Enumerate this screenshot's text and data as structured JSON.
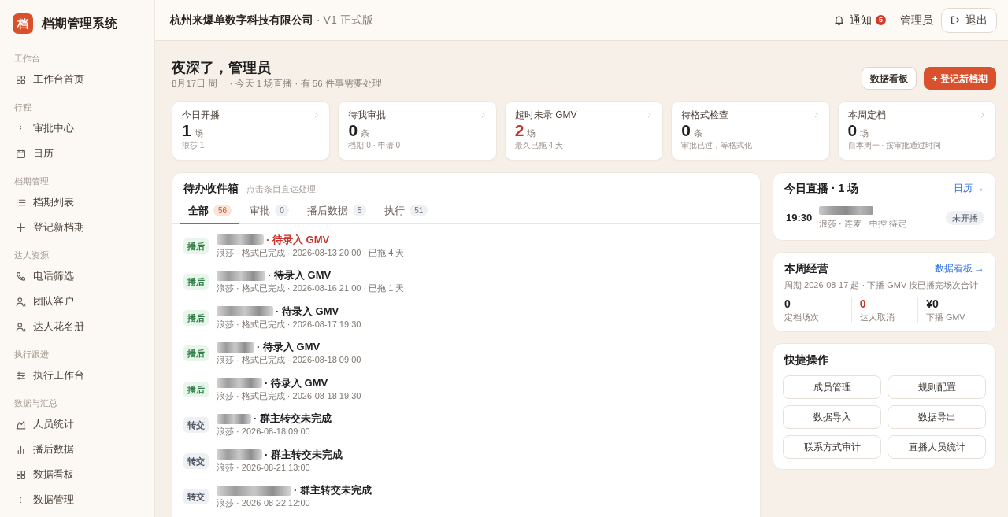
{
  "sidebar": {
    "logo": "档",
    "title": "档期管理系统",
    "sections": [
      {
        "label": "工作台",
        "items": [
          {
            "label": "工作台首页",
            "selected": false
          }
        ]
      },
      {
        "label": "行程",
        "items": [
          {
            "label": "审批中心",
            "selected": false
          },
          {
            "label": "日历",
            "selected": false
          }
        ]
      },
      {
        "label": "档期管理",
        "items": [
          {
            "label": "档期列表",
            "selected": false
          },
          {
            "label": "登记新档期",
            "selected": false
          }
        ]
      },
      {
        "label": "达人资源",
        "items": [
          {
            "label": "电话筛选",
            "selected": false
          },
          {
            "label": "团队客户",
            "selected": false
          },
          {
            "label": "达人花名册",
            "selected": false
          }
        ]
      },
      {
        "label": "执行跟进",
        "items": [
          {
            "label": "执行工作台",
            "selected": false
          }
        ]
      },
      {
        "label": "数据与汇总",
        "items": [
          {
            "label": "人员统计",
            "selected": false
          },
          {
            "label": "播后数据",
            "selected": false
          },
          {
            "label": "数据看板",
            "selected": false
          },
          {
            "label": "数据管理",
            "selected": false
          }
        ]
      }
    ]
  },
  "header": {
    "company": "杭州来爆单数字科技有限公司",
    "version": "· V1 正式版",
    "notifications": {
      "label": "通知",
      "count": "5"
    },
    "user": "管理员",
    "logout": "退出"
  },
  "greeting": {
    "title": "夜深了，管理员",
    "subtitle": "8月17日 周一 · 今天 1 场直播 · 有 56 件事需要处理"
  },
  "actions": [
    {
      "label": "数据看板",
      "kind": "secondary"
    },
    {
      "label": "+ 登记新档期",
      "kind": "primary"
    }
  ],
  "stats": [
    {
      "label": "今日开播",
      "value": "1",
      "unit": "场",
      "note": "浪莎 1",
      "alert": false
    },
    {
      "label": "待我审批",
      "value": "0",
      "unit": "条",
      "note": "档期 0 · 申请 0",
      "alert": false
    },
    {
      "label": "超时未录 GMV",
      "value": "2",
      "unit": "场",
      "note": "最久已拖 4 天",
      "alert": true
    },
    {
      "label": "待格式检查",
      "value": "0",
      "unit": "条",
      "note": "审批已过，等格式化",
      "alert": false
    },
    {
      "label": "本周定档",
      "value": "0",
      "unit": "场",
      "note": "自本周一 · 按审批通过时间",
      "alert": false
    }
  ],
  "inbox": {
    "title": "待办收件箱",
    "hint": "点击条目直达处理",
    "tabs": [
      {
        "label": "全部",
        "count": "56",
        "selected": true
      },
      {
        "label": "审批",
        "count": "0",
        "selected": false
      },
      {
        "label": "播后数据",
        "count": "5",
        "selected": false
      },
      {
        "label": "执行",
        "count": "51",
        "selected": false
      }
    ],
    "items": [
      {
        "tag": "播后",
        "kind": "post",
        "title": "· 待录入 GMV",
        "alert": true,
        "meta": "浪莎 · 格式已完成 · 2026-08-13 20:00 · 已拖 4 天"
      },
      {
        "tag": "播后",
        "kind": "post",
        "title": "· 待录入 GMV",
        "alert": false,
        "meta": "浪莎 · 格式已完成 · 2026-08-16 21:00 · 已拖 1 天"
      },
      {
        "tag": "播后",
        "kind": "post",
        "title": "· 待录入 GMV",
        "alert": false,
        "meta": "浪莎 · 格式已完成 · 2026-08-17 19:30"
      },
      {
        "tag": "播后",
        "kind": "post",
        "title": "· 待录入 GMV",
        "alert": false,
        "meta": "浪莎 · 格式已完成 · 2026-08-18 09:00"
      },
      {
        "tag": "播后",
        "kind": "post",
        "title": "· 待录入 GMV",
        "alert": false,
        "meta": "浪莎 · 格式已完成 · 2026-08-18 19:30"
      },
      {
        "tag": "转交",
        "kind": "handover",
        "title": "· 群主转交未完成",
        "alert": false,
        "meta": "浪莎 · 2026-08-18 09:00"
      },
      {
        "tag": "转交",
        "kind": "handover",
        "title": "· 群主转交未完成",
        "alert": false,
        "meta": "浪莎 · 2026-08-21 13:00"
      },
      {
        "tag": "转交",
        "kind": "handover",
        "title": "· 群主转交未完成",
        "alert": false,
        "meta": "浪莎 · 2026-08-22 12:00"
      }
    ]
  },
  "today_live": {
    "title": "今日直播 · 1 场",
    "link": "日历 →",
    "items": [
      {
        "time": "19:30",
        "meta": "浪莎 · 连麦 · 中控 待定",
        "status": "未开播"
      }
    ]
  },
  "weekly": {
    "title": "本周经营",
    "link": "数据看板 →",
    "note": "周期 2026-08-17 起 · 下播 GMV 按已播完场次合计",
    "metrics": [
      {
        "value": "0",
        "label": "定档场次",
        "alert": false
      },
      {
        "value": "0",
        "label": "达人取消",
        "alert": true
      },
      {
        "value": "¥0",
        "label": "下播 GMV",
        "alert": false
      }
    ]
  },
  "quick_actions": {
    "title": "快捷操作",
    "buttons": [
      "成员管理",
      "规则配置",
      "数据导入",
      "数据导出",
      "联系方式审计",
      "直播人员统计"
    ]
  }
}
